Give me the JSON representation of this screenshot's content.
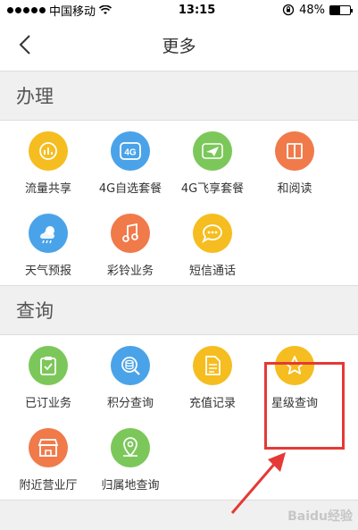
{
  "status_bar": {
    "carrier": "中国移动",
    "time": "13:15",
    "battery_text": "48%",
    "battery_level": 0.48
  },
  "nav": {
    "title": "更多"
  },
  "sections": [
    {
      "title": "办理"
    },
    {
      "title": "查询"
    }
  ],
  "handle": {
    "items": [
      {
        "label": "流量共享",
        "icon": "data-share-icon",
        "color": "#f5bd1f"
      },
      {
        "label": "4G自选套餐",
        "icon": "4g-icon",
        "color": "#4aa3e8"
      },
      {
        "label": "4G飞享套餐",
        "icon": "paper-plane-icon",
        "color": "#7cc75a"
      },
      {
        "label": "和阅读",
        "icon": "book-icon",
        "color": "#f07a4a"
      },
      {
        "label": "天气预报",
        "icon": "weather-icon",
        "color": "#4aa3e8"
      },
      {
        "label": "彩铃业务",
        "icon": "music-note-icon",
        "color": "#f07a4a"
      },
      {
        "label": "短信通话",
        "icon": "message-icon",
        "color": "#f5bd1f"
      }
    ]
  },
  "query": {
    "items": [
      {
        "label": "已订业务",
        "icon": "clipboard-check-icon",
        "color": "#7cc75a"
      },
      {
        "label": "积分查询",
        "icon": "coins-search-icon",
        "color": "#4aa3e8"
      },
      {
        "label": "充值记录",
        "icon": "document-icon",
        "color": "#f5bd1f"
      },
      {
        "label": "星级查询",
        "icon": "star-icon",
        "color": "#f5bd1f"
      },
      {
        "label": "附近营业厅",
        "icon": "store-icon",
        "color": "#f07a4a"
      },
      {
        "label": "归属地查询",
        "icon": "location-pin-icon",
        "color": "#7cc75a"
      }
    ]
  },
  "watermark": "Baidu经验"
}
